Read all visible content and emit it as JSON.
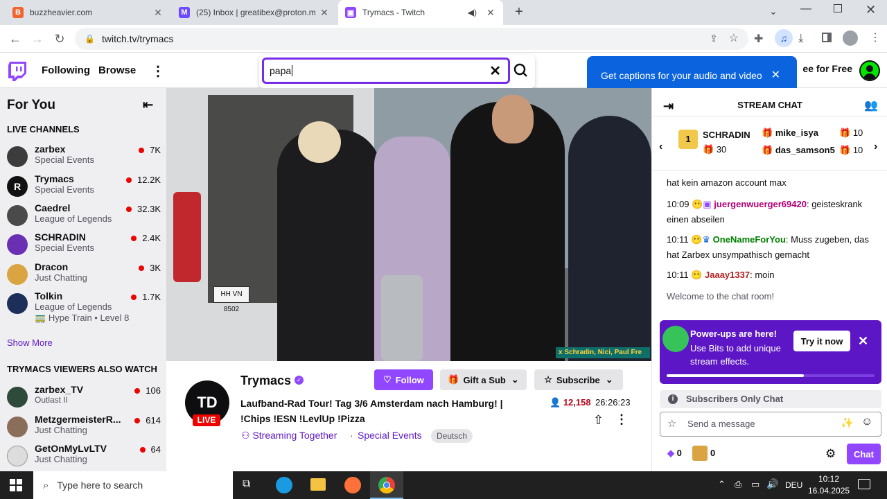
{
  "browser": {
    "tabs": [
      {
        "title": "buzzheavier.com",
        "active": false
      },
      {
        "title": "(25) Inbox | greatibex@proton.m",
        "active": false
      },
      {
        "title": "Trymacs - Twitch",
        "active": true
      }
    ],
    "url": "twitch.tv/trymacs"
  },
  "topnav": {
    "following": "Following",
    "browse": "Browse",
    "search_value": "papa",
    "captions_text": "Get captions for your audio and video",
    "free_label": "ee for Free"
  },
  "sidebar": {
    "heading": "For You",
    "live_title": "LIVE CHANNELS",
    "live": [
      {
        "name": "zarbex",
        "category": "Special Events",
        "viewers": "7K"
      },
      {
        "name": "Trymacs",
        "category": "Special Events",
        "viewers": "12.2K"
      },
      {
        "name": "Caedrel",
        "category": "League of Legends",
        "viewers": "32.3K"
      },
      {
        "name": "SCHRADIN",
        "category": "Special Events",
        "viewers": "2.4K"
      },
      {
        "name": "Dracon",
        "category": "Just Chatting",
        "viewers": "3K"
      },
      {
        "name": "Tolkin",
        "category": "League of Legends",
        "viewers": "1.7K"
      }
    ],
    "hype_train": "Hype Train • Level 8",
    "show_more": "Show More",
    "also_title": "TRYMACS VIEWERS ALSO WATCH",
    "also": [
      {
        "name": "zarbex_TV",
        "category": "Outlast II",
        "viewers": "106"
      },
      {
        "name": "MetzgermeisterR...",
        "category": "Just Chatting",
        "viewers": "614"
      },
      {
        "name": "GetOnMyLvLTV",
        "category": "Just Chatting",
        "viewers": "64"
      }
    ]
  },
  "video": {
    "overlay_text": "x Schradin, Nici, Paul Fre"
  },
  "info": {
    "channel": "Trymacs",
    "live_badge": "LIVE",
    "follow": "Follow",
    "gift": "Gift a Sub",
    "subscribe": "Subscribe",
    "title_line1": "Laufband-Rad Tour! Tag 3/6 Amsterdam nach Hamburg! |",
    "title_line2": "!Chips !ESN !LevlUp !Pizza",
    "viewers": "12,158",
    "uptime": "26:26:23",
    "streaming_together": "Streaming Together",
    "separator": "·",
    "category": "Special Events",
    "tag": "Deutsch"
  },
  "chat": {
    "header": "STREAM CHAT",
    "leaderboard": {
      "left_name": "SCHRADIN",
      "left_count": "30",
      "right": [
        {
          "name": "mike_isya",
          "count": "10"
        },
        {
          "name": "das_samson5",
          "count": "10"
        }
      ]
    },
    "messages": [
      {
        "time": "",
        "user": "",
        "text": "hat kein amazon account max",
        "color": "#0e0e10"
      },
      {
        "time": "10:09",
        "user": "juergenwuerger69420",
        "text": "geisteskrank einen abseilen",
        "color": "#b30077"
      },
      {
        "time": "10:11",
        "user": "OneNameForYou",
        "text": "Muss zugeben, das hat Zarbex unsympathisch gemacht",
        "color": "#008000"
      },
      {
        "time": "10:11",
        "user": "Jaaay1337",
        "text": "moin",
        "color": "#b22222"
      }
    ],
    "welcome": "Welcome to the chat room!",
    "powerups_title": "Power-ups are here!",
    "powerups_body": "Use Bits to add unique stream effects.",
    "try_it": "Try it now",
    "subs_only": "Subscribers Only Chat",
    "placeholder": "Send a message",
    "bits": "0",
    "points": "0",
    "chat_button": "Chat"
  },
  "taskbar": {
    "search_placeholder": "Type here to search",
    "lang": "DEU",
    "time": "10:12",
    "date": "16.04.2025"
  },
  "colors": {
    "twitch_purple": "#9147ff",
    "search_border": "#772ce8",
    "live_red": "#eb0400",
    "caption_blue": "#0b64dd"
  }
}
